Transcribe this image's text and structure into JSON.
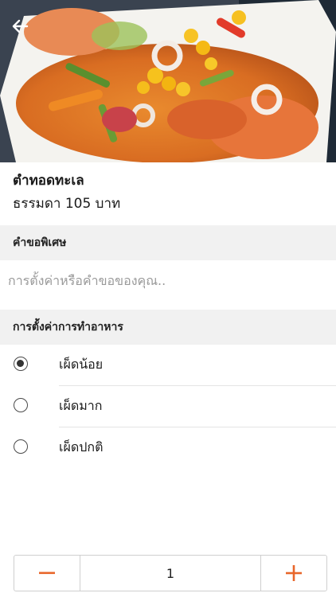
{
  "item": {
    "name": "ตำทอดทะเล",
    "price_line": "ธรรมดา 105 บาท"
  },
  "special_request": {
    "header": "คำขอพิเศษ",
    "placeholder": "การตั้งค่าหรือคำขอของคุณ..",
    "value": ""
  },
  "cooking_settings": {
    "header": "การตั้งค่าการทำอาหาร",
    "options": [
      {
        "label": "เผ็ดน้อย",
        "selected": true
      },
      {
        "label": "เผ็ดมาก",
        "selected": false
      },
      {
        "label": "เผ็ดปกติ",
        "selected": false
      }
    ]
  },
  "quantity": {
    "value": "1"
  },
  "icons": {
    "back": "back-arrow-icon",
    "decrease": "minus-icon",
    "increase": "plus-icon"
  },
  "colors": {
    "accent": "#e8662a",
    "section_bg": "#f1f1f1"
  }
}
